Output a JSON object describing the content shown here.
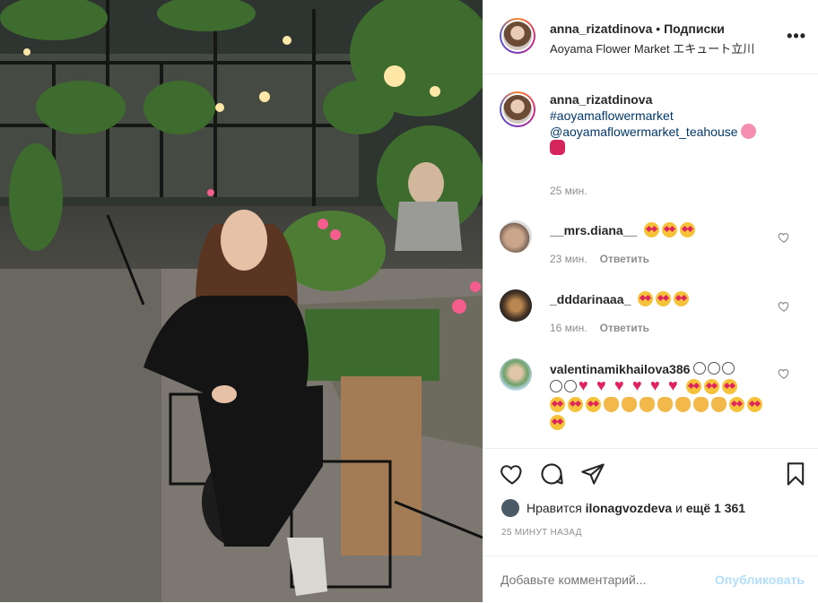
{
  "header": {
    "username": "anna_rizatdinova",
    "separator": " • ",
    "follow_label": "Подписки",
    "location": "Aoyama Flower Market エキュート立川",
    "more_label": "•••"
  },
  "caption": {
    "username": "anna_rizatdinova",
    "hashtag": "#aoyamaflowermarket",
    "mention": "@aoyamaflowermarket_teahouse",
    "time": "25 мин."
  },
  "comments": [
    {
      "username": "__mrs.diana__",
      "emoji": [
        "heart-eyes",
        "heart-eyes",
        "heart-eyes"
      ],
      "time": "23 мин.",
      "reply_label": "Ответить"
    },
    {
      "username": "_dddarinaaa_",
      "emoji": [
        "heart-eyes",
        "heart-eyes",
        "heart-eyes"
      ],
      "time": "16 мин.",
      "reply_label": "Ответить"
    },
    {
      "username": "valentinamikhailova386",
      "emoji": [
        "smile",
        "smile",
        "smile",
        "smile",
        "smile",
        "red-heart",
        "red-heart",
        "red-heart",
        "red-heart",
        "red-heart",
        "red-heart",
        "heart-eyes",
        "heart-eyes",
        "heart-eyes",
        "heart-eyes",
        "heart-eyes",
        "heart-eyes",
        "clap",
        "clap",
        "clap",
        "clap",
        "clap",
        "clap",
        "clap",
        "heart-eyes",
        "heart-eyes",
        "heart-eyes"
      ]
    }
  ],
  "likes": {
    "prefix": "Нравится ",
    "user": "ilonagvozdeva",
    "middle": " и ",
    "others": "ещё 1 361"
  },
  "timestamp": "25 МИНУТ НАЗАД",
  "add_comment": {
    "placeholder": "Добавьте комментарий...",
    "publish_label": "Опубликовать"
  },
  "colors": {
    "link": "#00376b",
    "muted": "#8e8e8e",
    "publish_disabled": "#b2dffc"
  }
}
